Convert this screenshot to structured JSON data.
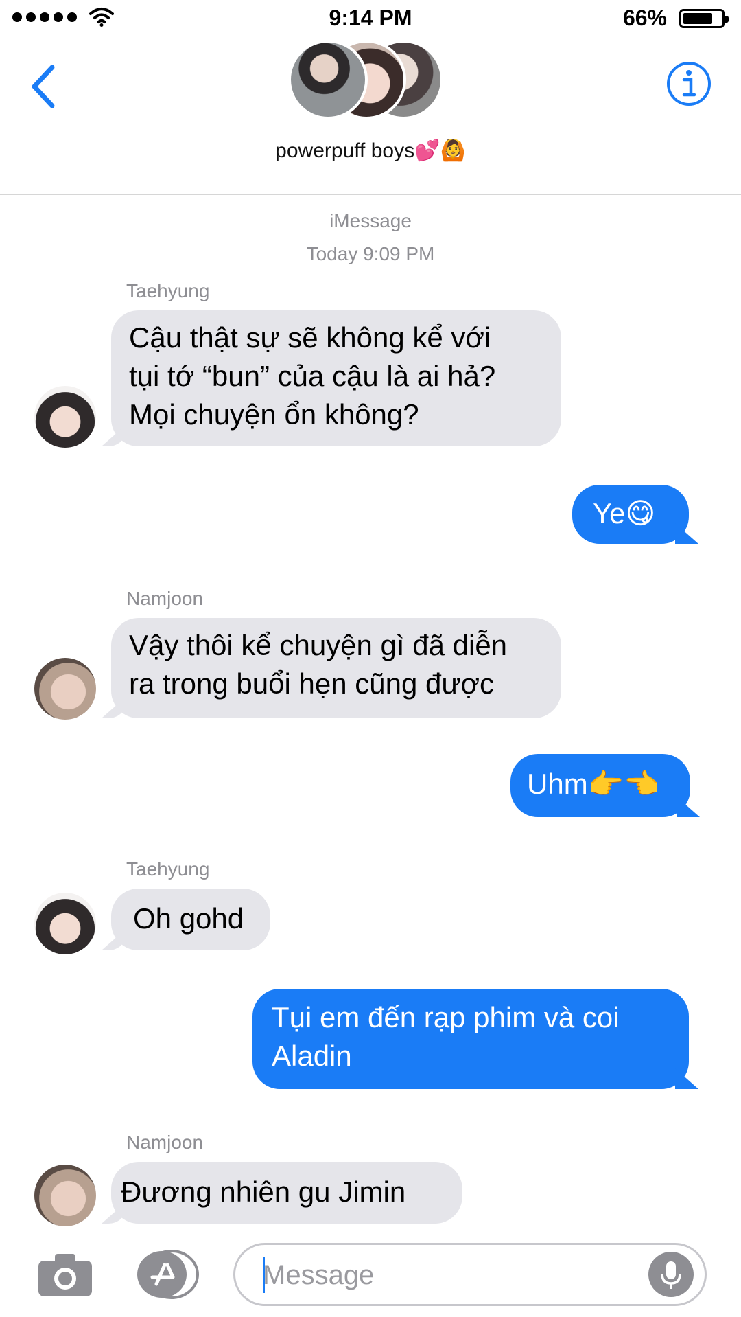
{
  "status_bar": {
    "time": "9:14 PM",
    "battery": "66%"
  },
  "header": {
    "group_name": "powerpuff boys",
    "group_emoji": "💕🙆",
    "back_icon": "chevron-left-icon",
    "info_icon": "info-icon"
  },
  "thread": {
    "service": "iMessage",
    "timestamp": "Today 9:09 PM"
  },
  "messages": [
    {
      "sender": "Taehyung",
      "direction": "in",
      "lines": [
        "Cậu thật sự sẽ không kể với",
        "tụi tớ “bun” của cậu là ai hả?",
        "Mọi chuyện ổn không?"
      ]
    },
    {
      "direction": "out",
      "lines": [
        "Ye😋"
      ]
    },
    {
      "sender": "Namjoon",
      "direction": "in",
      "lines": [
        "Vậy thôi kể chuyện gì đã diễn",
        "ra trong buổi hẹn cũng được"
      ]
    },
    {
      "direction": "out",
      "lines": [
        "Uhm👉👈"
      ]
    },
    {
      "sender": "Taehyung",
      "direction": "in",
      "lines": [
        "Oh gohd"
      ]
    },
    {
      "direction": "out",
      "lines": [
        "Tụi em đến rạp phim và coi",
        "Aladin"
      ]
    },
    {
      "sender": "Namjoon",
      "direction": "in",
      "lines": [
        "Đương nhiên gu Jimin"
      ]
    }
  ],
  "input": {
    "placeholder": "Message",
    "value": ""
  },
  "colors": {
    "accent": "#1a7cf6",
    "incoming_bubble": "#e5e5ea",
    "meta_text": "#8e8e93"
  }
}
